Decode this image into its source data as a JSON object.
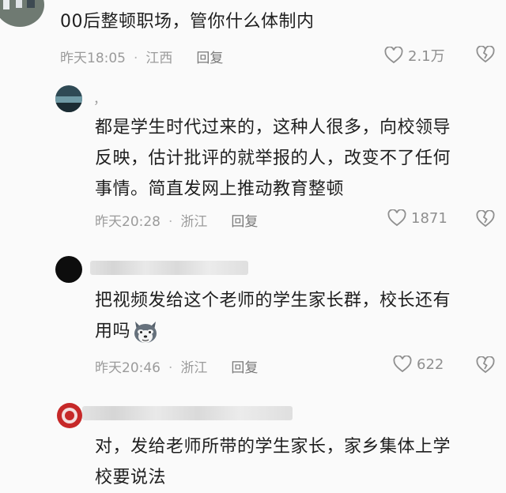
{
  "comments": [
    {
      "text_lines": [
        "00后整顿职场，管你什么体制内"
      ],
      "time": "昨天18:05",
      "location": "江西",
      "reply": "回复",
      "likes": "2.1万"
    },
    {
      "username": "，",
      "text_lines": [
        "都是学生时代过来的，这种人很多，向校领导",
        "反映，估计批评的就举报的人，改变不了任何",
        "事情。简直发网上推动教育整顿"
      ],
      "time": "昨天20:28",
      "location": "浙江",
      "reply": "回复",
      "likes": "1871"
    },
    {
      "text_lines": [
        "把视频发给这个老师的学生家长群，校长还有",
        "用吗"
      ],
      "time": "昨天20:46",
      "location": "浙江",
      "reply": "回复",
      "likes": "622"
    },
    {
      "text_lines": [
        "对，发给老师所带的学生家长，家乡集体上学",
        "校要说法"
      ]
    }
  ],
  "icons": {
    "like": "heart-outline-icon",
    "dislike": "broken-heart-icon",
    "emoji": "husky-dog-emoji-icon"
  },
  "colors": {
    "text": "#1f1f1f",
    "meta": "#9b9b9b",
    "background": "#fafafa"
  }
}
